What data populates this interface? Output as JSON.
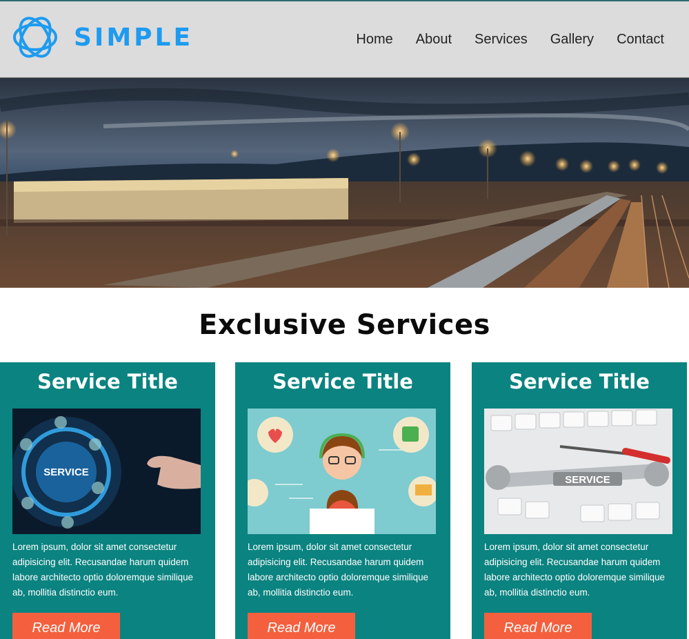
{
  "brand": {
    "name": "SIMPLE",
    "logo_icon": "interlocking-rings-icon",
    "color": "#1e9bf0"
  },
  "nav": {
    "items": [
      "Home",
      "About",
      "Services",
      "Gallery",
      "Contact"
    ]
  },
  "hero": {
    "image": "railway-yard-night-photo"
  },
  "services": {
    "heading": "Exclusive Services",
    "cards": [
      {
        "title": "Service Title",
        "image": "service-tech-hand-photo",
        "text": "Lorem ipsum, dolor sit amet consectetur adipisicing elit. Recusandae harum quidem labore architecto optio doloremque similique ab, mollitia distinctio eum.",
        "button": "Read More"
      },
      {
        "title": "Service Title",
        "image": "customer-support-agent-illustration",
        "text": "Lorem ipsum, dolor sit amet consectetur adipisicing elit. Recusandae harum quidem labore architecto optio doloremque similique ab, mollitia distinctio eum.",
        "button": "Read More"
      },
      {
        "title": "Service Title",
        "image": "wrenches-keyboard-photo",
        "text": "Lorem ipsum, dolor sit amet consectetur adipisicing elit. Recusandae harum quidem labore architecto optio doloremque similique ab, mollitia distinctio eum.",
        "button": "Read More"
      }
    ]
  },
  "colors": {
    "card_bg": "#0b8380",
    "button_bg": "#f4603e",
    "header_bg": "#dcdcdc"
  }
}
